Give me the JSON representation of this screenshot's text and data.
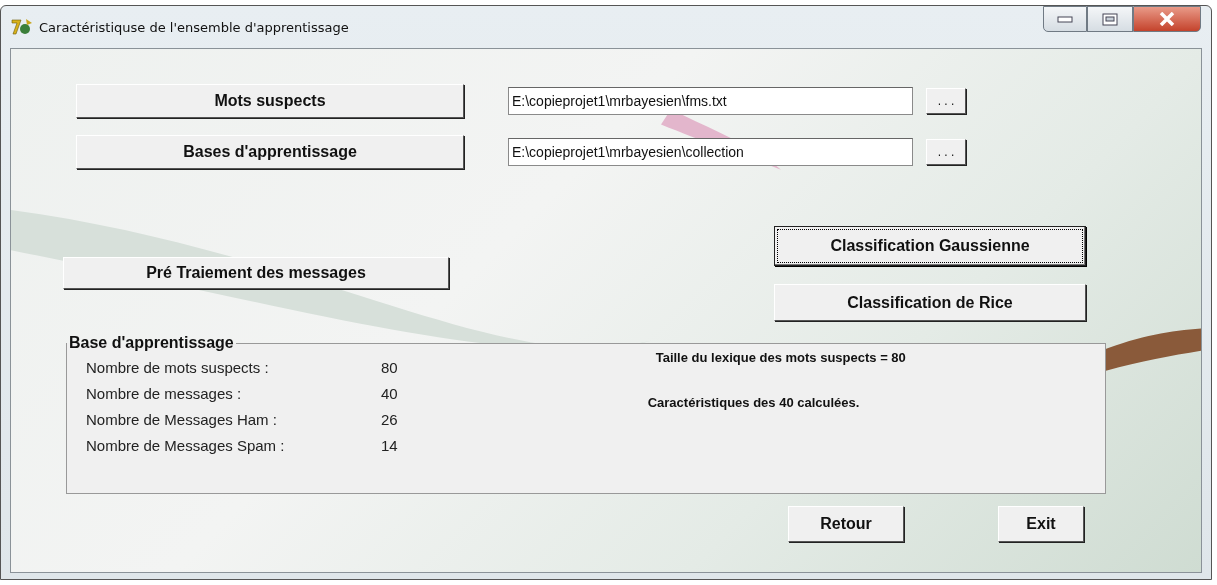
{
  "window": {
    "title": "Caractéristiquse de l'ensemble d'apprentissage"
  },
  "file_rows": [
    {
      "button": "Mots suspects",
      "path": "E:\\copieprojet1\\mrbayesien\\fms.txt",
      "browse": ". . ."
    },
    {
      "button": "Bases d'apprentissage",
      "path": "E:\\copieprojet1\\mrbayesien\\collection",
      "browse": ". . ."
    }
  ],
  "preprocess_button": "Pré Traiement des messages",
  "classification_buttons": [
    {
      "label": "Classification Gaussienne",
      "focused": true
    },
    {
      "label": "Classification de Rice",
      "focused": false
    }
  ],
  "group": {
    "title": "Base d'apprentissage",
    "stats": [
      {
        "label": "Nombre de mots suspects  :",
        "value": "80"
      },
      {
        "label": "Nombre de messages :",
        "value": "40"
      },
      {
        "label": "Nombre de Messages Ham :",
        "value": "26"
      },
      {
        "label": "Nombre de Messages Spam :",
        "value": "14"
      }
    ],
    "messages": [
      "Taille du lexique des mots suspects = 80",
      "Caractéristiques des 40 calculées."
    ]
  },
  "footer_buttons": [
    "Retour",
    "Exit"
  ]
}
